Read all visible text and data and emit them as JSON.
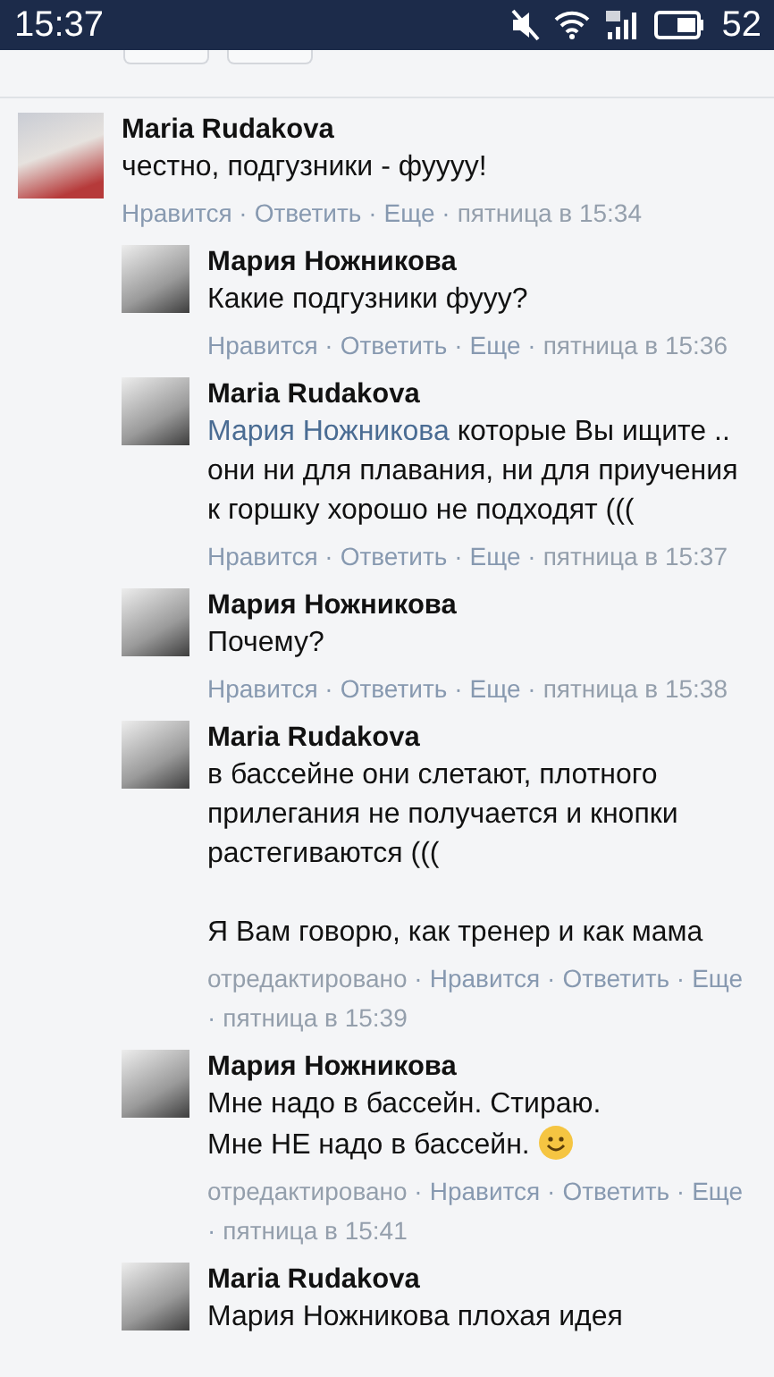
{
  "status_bar": {
    "time": "15:37",
    "battery": "52"
  },
  "comments": [
    {
      "author": "Maria Rudakova",
      "text": "честно, подгузники - фуууу!",
      "meta": [
        {
          "kind": "link",
          "text": "Нравится"
        },
        {
          "kind": "link",
          "sep": "·",
          "text": "Ответить"
        },
        {
          "kind": "link",
          "sep": "·",
          "text": "Еще"
        },
        {
          "kind": "time",
          "sep": "·",
          "text": "пятница в 15:34"
        }
      ],
      "children": [
        {
          "author": "Мария Ножникова",
          "text": "Какие подгузники фууу?",
          "meta": [
            {
              "kind": "link",
              "text": "Нравится"
            },
            {
              "kind": "link",
              "sep": "·",
              "text": "Ответить"
            },
            {
              "kind": "link",
              "sep": "·",
              "text": "Еще"
            },
            {
              "kind": "time",
              "sep": "·",
              "text": "пятница в 15:36"
            }
          ]
        },
        {
          "author": "Maria Rudakova",
          "mention": "Мария Ножникова",
          "text": "которые Вы ищите .. они ни для плавания, ни для приучения к горшку хорошо не подходят (((",
          "meta": [
            {
              "kind": "link",
              "text": "Нравится"
            },
            {
              "kind": "link",
              "sep": "·",
              "text": "Ответить"
            },
            {
              "kind": "link",
              "sep": "·",
              "text": "Еще"
            },
            {
              "kind": "time",
              "sep": "·",
              "text": "пятница в 15:37"
            }
          ]
        },
        {
          "author": "Мария Ножникова",
          "text": "Почему?",
          "meta": [
            {
              "kind": "link",
              "text": "Нравится"
            },
            {
              "kind": "link",
              "sep": "·",
              "text": "Ответить"
            },
            {
              "kind": "link",
              "sep": "·",
              "text": "Еще"
            },
            {
              "kind": "time",
              "sep": "·",
              "text": "пятница в 15:38"
            }
          ]
        },
        {
          "author": "Maria Rudakova",
          "text": "в бассейне они слетают, плотного прилегания не получается и кнопки растегиваются (((\n\nЯ Вам говорю, как тренер и как мама",
          "meta": [
            {
              "kind": "label",
              "text": "отредактировано"
            },
            {
              "kind": "link",
              "sep": "·",
              "text": "Нравится"
            },
            {
              "kind": "link",
              "sep": "·",
              "text": "Ответить"
            },
            {
              "kind": "link",
              "sep": "·",
              "text": "Еще"
            },
            {
              "kind": "time",
              "sep": "·",
              "text": "пятница в 15:39"
            }
          ]
        },
        {
          "author": "Мария Ножникова",
          "text": "Мне надо в бассейн. Стираю.\nМне НЕ надо в бассейн.",
          "smiley": true,
          "meta": [
            {
              "kind": "label",
              "text": "отредактировано"
            },
            {
              "kind": "link",
              "sep": "·",
              "text": "Нравится"
            },
            {
              "kind": "link",
              "sep": "·",
              "text": "Ответить"
            },
            {
              "kind": "link",
              "sep": "·",
              "text": "Еще"
            },
            {
              "kind": "time",
              "sep": "·",
              "text": "пятница в 15:41"
            }
          ]
        },
        {
          "author": "Maria Rudakova",
          "text": "Мария Ножникова плохая идея"
        }
      ]
    }
  ]
}
